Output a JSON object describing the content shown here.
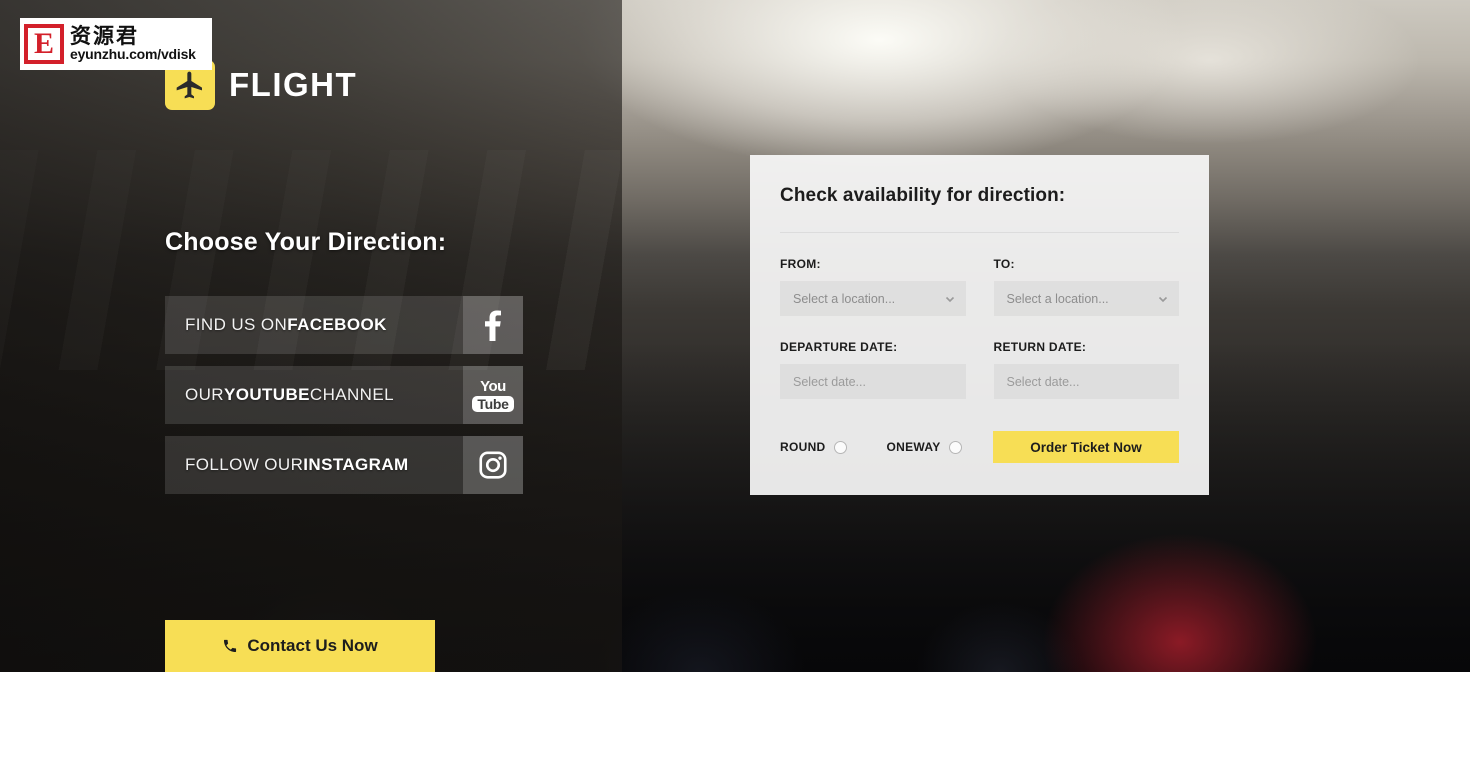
{
  "watermark": {
    "logo_letter": "E",
    "chinese_text": "资源君",
    "url_text": "eyunzhu.com/vdisk"
  },
  "brand": {
    "icon": "airplane-icon",
    "name": "FLIGHT"
  },
  "left": {
    "heading": "Choose Your Direction:",
    "social": [
      {
        "prefix": "FIND US ON ",
        "emphasis": "FACEBOOK",
        "suffix": "",
        "icon": "facebook-icon"
      },
      {
        "prefix": "OUR ",
        "emphasis": "YOUTUBE",
        "suffix": " CHANNEL",
        "icon": "youtube-icon"
      },
      {
        "prefix": "FOLLOW OUR ",
        "emphasis": "INSTAGRAM",
        "suffix": "",
        "icon": "instagram-icon"
      }
    ],
    "contact_button": {
      "label": "Contact Us Now",
      "icon": "phone-icon"
    }
  },
  "form": {
    "title": "Check availability for direction:",
    "from_label": "FROM:",
    "from_value": "Select a location...",
    "to_label": "TO:",
    "to_value": "Select a location...",
    "departure_label": "DEPARTURE DATE:",
    "departure_placeholder": "Select date...",
    "return_label": "RETURN DATE:",
    "return_placeholder": "Select date...",
    "round_label": "ROUND",
    "oneway_label": "ONEWAY",
    "submit_label": "Order Ticket Now"
  },
  "colors": {
    "accent_yellow": "#f7de55",
    "text_dark": "#1c1c1c",
    "panel_bg": "#f8f8f8"
  }
}
